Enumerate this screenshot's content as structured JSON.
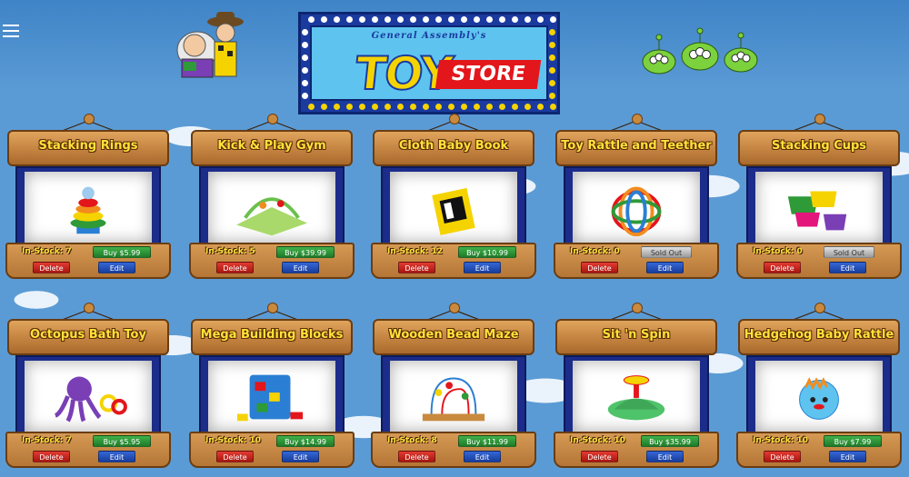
{
  "header": {
    "menu_icon": "hamburger-menu-icon",
    "logo": {
      "subtitle": "General Assembly's",
      "word_toy": "TOY",
      "word_store": "STORE"
    }
  },
  "colors": {
    "sky": "#5b9bd5",
    "wood": "#c1803e",
    "title_yellow": "#ffe23a",
    "buy_green": "#2e9a38",
    "delete_red": "#d0241c",
    "edit_blue": "#2653bf"
  },
  "products": [
    {
      "name": "Stacking Rings",
      "stock_label": "In-Stock: 7",
      "action_label": "Buy $5.99",
      "sold_out": false,
      "image": "stacking-rings",
      "delete_label": "Delete",
      "edit_label": "Edit"
    },
    {
      "name": "Kick & Play Gym",
      "stock_label": "In-Stock: 5",
      "action_label": "Buy $39.99",
      "sold_out": false,
      "image": "play-gym",
      "delete_label": "Delete",
      "edit_label": "Edit"
    },
    {
      "name": "Cloth Baby Book",
      "stock_label": "In-Stock: 12",
      "action_label": "Buy $10.99",
      "sold_out": false,
      "image": "cloth-book",
      "delete_label": "Delete",
      "edit_label": "Edit"
    },
    {
      "name": "Toy Rattle and Teether",
      "stock_label": "In-Stock: 0",
      "action_label": "Sold Out",
      "sold_out": true,
      "image": "rattle-teether",
      "delete_label": "Delete",
      "edit_label": "Edit"
    },
    {
      "name": "Stacking Cups",
      "stock_label": "In-Stock: 0",
      "action_label": "Sold Out",
      "sold_out": true,
      "image": "stacking-cups",
      "delete_label": "Delete",
      "edit_label": "Edit"
    },
    {
      "name": "Octopus Bath Toy",
      "stock_label": "In-Stock: 7",
      "action_label": "Buy $5.95",
      "sold_out": false,
      "image": "octopus",
      "delete_label": "Delete",
      "edit_label": "Edit"
    },
    {
      "name": "Mega Building Blocks",
      "stock_label": "In-Stock: 10",
      "action_label": "Buy $14.99",
      "sold_out": false,
      "image": "blocks",
      "delete_label": "Delete",
      "edit_label": "Edit"
    },
    {
      "name": "Wooden Bead Maze",
      "stock_label": "In-Stock: 8",
      "action_label": "Buy $11.99",
      "sold_out": false,
      "image": "bead-maze",
      "delete_label": "Delete",
      "edit_label": "Edit"
    },
    {
      "name": "Sit 'n Spin",
      "stock_label": "In-Stock: 10",
      "action_label": "Buy $35.99",
      "sold_out": false,
      "image": "sit-n-spin",
      "delete_label": "Delete",
      "edit_label": "Edit"
    },
    {
      "name": "Hedgehog Baby Rattle",
      "stock_label": "In-Stock: 10",
      "action_label": "Buy $7.99",
      "sold_out": false,
      "image": "hedgehog-rattle",
      "delete_label": "Delete",
      "edit_label": "Edit"
    }
  ]
}
